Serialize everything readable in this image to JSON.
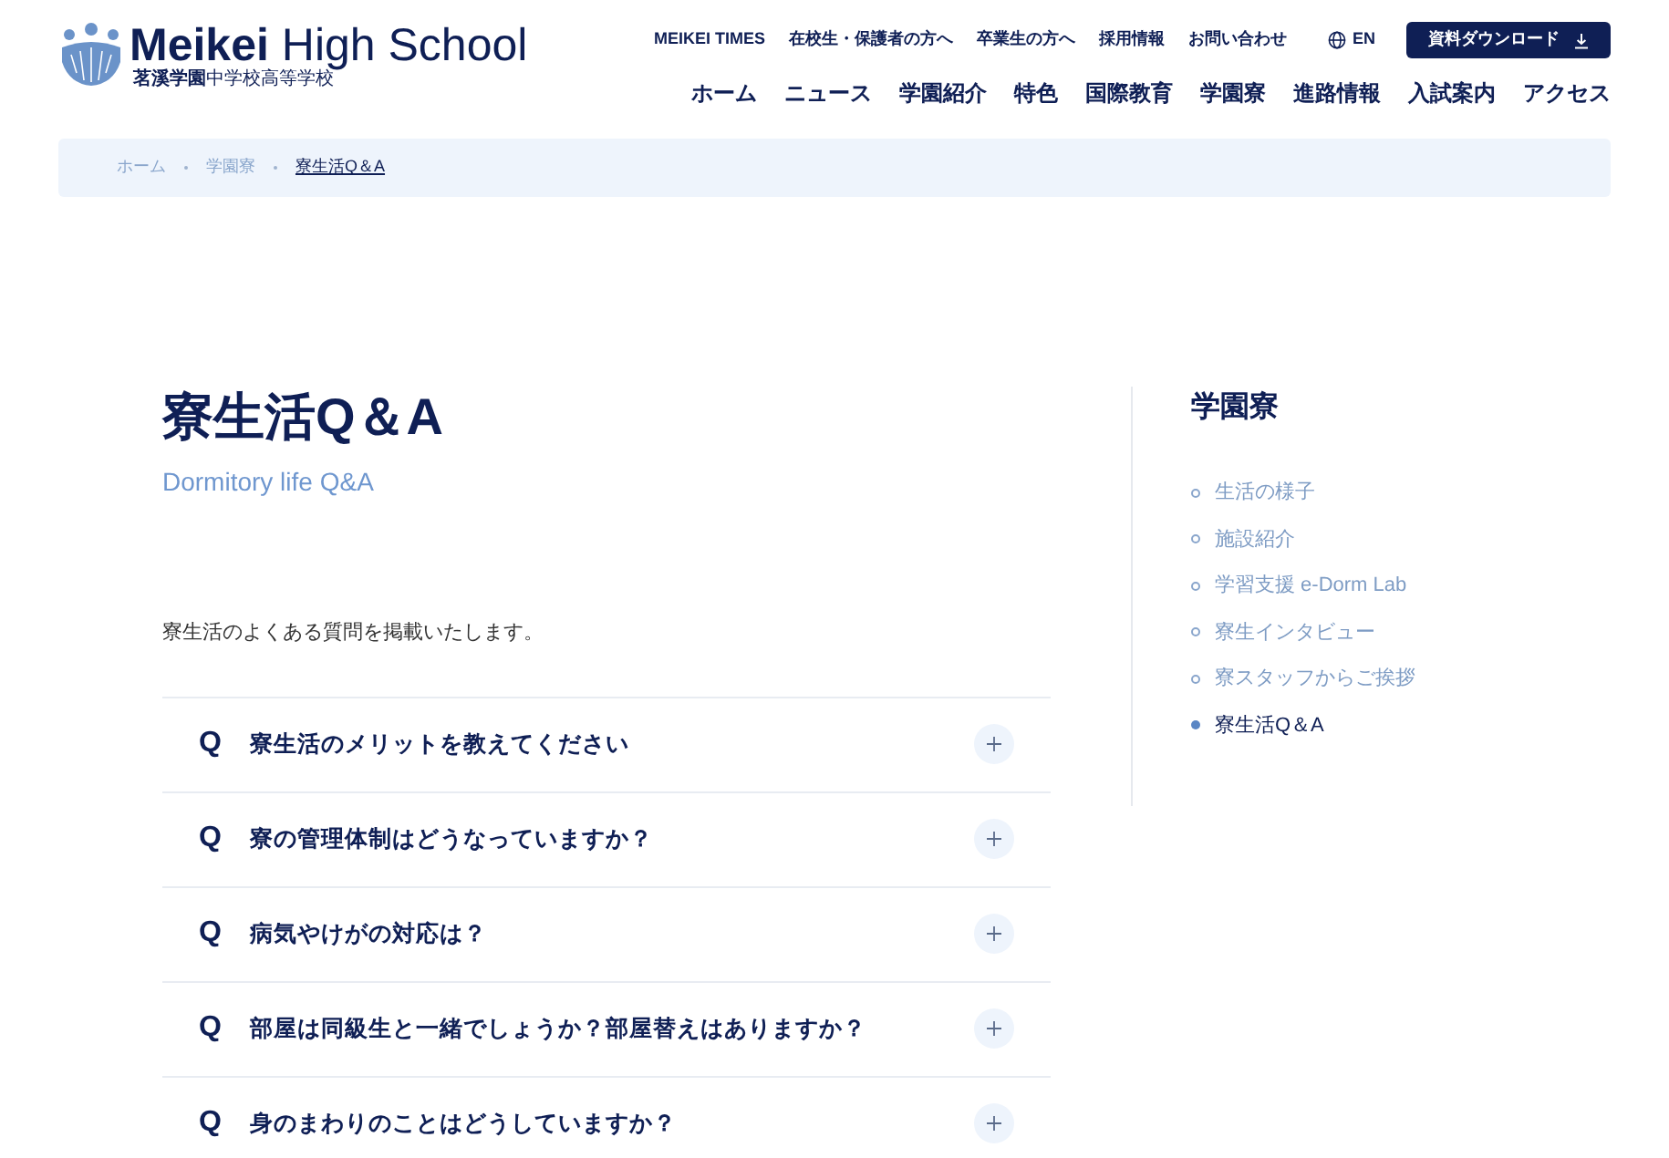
{
  "logo": {
    "title_bold": "Meikei",
    "title_light": "High School",
    "subtitle_bold": "茗溪学園",
    "subtitle_light": "中学校高等学校"
  },
  "top_links": [
    "MEIKEI TIMES",
    "在校生・保護者の方へ",
    "卒業生の方へ",
    "採用情報",
    "お問い合わせ"
  ],
  "language": "EN",
  "download_button": "資料ダウンロード",
  "nav": [
    "ホーム",
    "ニュース",
    "学園紹介",
    "特色",
    "国際教育",
    "学園寮",
    "進路情報",
    "入試案内",
    "アクセス"
  ],
  "breadcrumb": [
    {
      "label": "ホーム",
      "selected": false
    },
    {
      "label": "学園寮",
      "selected": false
    },
    {
      "label": "寮生活Q＆A",
      "selected": true
    }
  ],
  "page_title": "寮生活Q＆A",
  "page_subtitle": "Dormitory life Q&A",
  "intro": "寮生活のよくある質問を掲載いたします。",
  "faq": [
    {
      "mark": "Q",
      "question": "寮生活のメリットを教えてください",
      "expanded": false
    },
    {
      "mark": "Q",
      "question": "寮の管理体制はどうなっていますか？",
      "expanded": false
    },
    {
      "mark": "Q",
      "question": "病気やけがの対応は？",
      "expanded": false
    },
    {
      "mark": "Q",
      "question": "部屋は同級生と一緒でしょうか？部屋替えはありますか？",
      "expanded": false
    },
    {
      "mark": "Q",
      "question": "身のまわりのことはどうしていますか？",
      "expanded": false
    }
  ],
  "sidebar": {
    "title": "学園寮",
    "items": [
      {
        "label": "生活の様子",
        "selected": false
      },
      {
        "label": "施設紹介",
        "selected": false
      },
      {
        "label": "学習支援 e-Dorm Lab",
        "selected": false
      },
      {
        "label": "寮生インタビュー",
        "selected": false
      },
      {
        "label": "寮スタッフからご挨拶",
        "selected": false
      },
      {
        "label": "寮生活Q＆A",
        "selected": true
      }
    ]
  }
}
